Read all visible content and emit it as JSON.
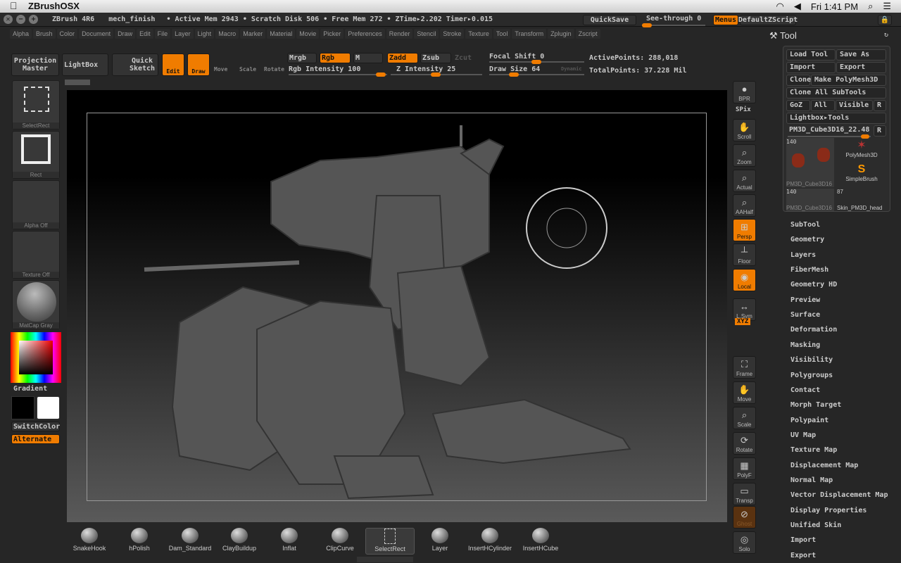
{
  "macbar": {
    "app": "ZBrushOSX",
    "clock": "Fri 1:41 PM"
  },
  "titlebar": {
    "version": "ZBrush 4R6",
    "document": "mech_finish",
    "stats": "• Active Mem 2943 • Scratch Disk 506 • Free Mem 272 • ZTime▸2.202 Timer▸0.015",
    "quicksave": "QuickSave",
    "seethrough": "See-through  0",
    "seethrough_value": 0,
    "menus": "Menus",
    "script": "DefaultZScript"
  },
  "menus": [
    "Alpha",
    "Brush",
    "Color",
    "Document",
    "Draw",
    "Edit",
    "File",
    "Layer",
    "Light",
    "Macro",
    "Marker",
    "Material",
    "Movie",
    "Picker",
    "Preferences",
    "Render",
    "Stencil",
    "Stroke",
    "Texture",
    "Tool",
    "Transform",
    "Zplugin",
    "Zscript"
  ],
  "shelf": {
    "projection_master": "Projection Master",
    "lightbox": "LightBox",
    "quick_sketch": "Quick Sketch",
    "edit": "Edit",
    "draw": "Draw",
    "move": "Move",
    "scale": "Scale",
    "rotate": "Rotate",
    "mrgb": "Mrgb",
    "rgb": "Rgb",
    "m": "M",
    "rgb_intensity": "Rgb Intensity 100",
    "zadd": "Zadd",
    "zsub": "Zsub",
    "zcut": "Zcut",
    "z_intensity": "Z Intensity 25",
    "focal_shift": "Focal Shift 0",
    "draw_size": "Draw Size 64",
    "dynamic": "Dynamic",
    "active_points": "ActivePoints: 288,018",
    "total_points": "TotalPoints: 37.228 Mil"
  },
  "left_tray": {
    "items": [
      "SelectRect",
      "Rect",
      "Alpha Off",
      "Texture Off",
      "MatCap Gray"
    ],
    "gradient": "Gradient",
    "switch_color": "SwitchColor",
    "alternate": "Alternate",
    "primary_color": "#000000",
    "secondary_color": "#ffffff"
  },
  "right_icons": [
    "BPR",
    "SPix",
    "Scroll",
    "Zoom",
    "Actual",
    "AAHalf",
    "Persp",
    "Floor",
    "Local",
    "L.Sym",
    "XYZ",
    "Frame",
    "Move",
    "Scale",
    "Rotate",
    "PolyF",
    "Transp",
    "Ghost",
    "Solo"
  ],
  "tool_panel": {
    "title": "Tool",
    "load_tool": "Load Tool",
    "save_as": "Save As",
    "import": "Import",
    "export": "Export",
    "clone": "Clone",
    "make_polymesh": "Make PolyMesh3D",
    "clone_all": "Clone All SubTools",
    "goz": "GoZ",
    "all": "All",
    "visible": "Visible",
    "r": "R",
    "lightbox_tools": "Lightbox▸Tools",
    "current_tool": "PM3D_Cube3D16_22.48",
    "thumbs": [
      {
        "count": "140",
        "name": "PM3D_Cube3D16"
      },
      {
        "count": "",
        "name": "PolyMesh3D"
      },
      {
        "count": "",
        "name": "SimpleBrush"
      },
      {
        "count": "140",
        "name": "PM3D_Cube3D16"
      },
      {
        "count": "87",
        "name": "Skin_PM3D_head"
      }
    ],
    "sections": [
      "SubTool",
      "Geometry",
      "Layers",
      "FiberMesh",
      "Geometry HD",
      "Preview",
      "Surface",
      "Deformation",
      "Masking",
      "Visibility",
      "Polygroups",
      "Contact",
      "Morph Target",
      "Polypaint",
      "UV Map",
      "Texture Map",
      "Displacement Map",
      "Normal Map",
      "Vector Displacement Map",
      "Display Properties",
      "Unified Skin",
      "Import",
      "Export"
    ]
  },
  "brushes": [
    "SnakeHook",
    "hPolish",
    "Dam_Standard",
    "ClayBuildup",
    "Inflat",
    "ClipCurve",
    "SelectRect",
    "Layer",
    "InsertHCylinder",
    "InsertHCube"
  ],
  "accent": "#f07c00"
}
